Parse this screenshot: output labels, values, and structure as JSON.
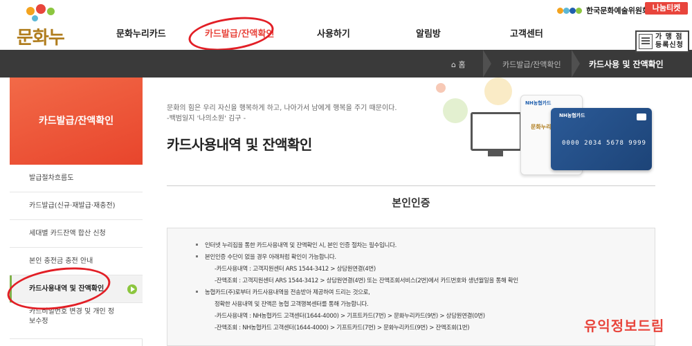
{
  "header": {
    "logo_text": "문화누리",
    "gnb": [
      "문화누리카드",
      "카드발급/잔액확인",
      "사용하기",
      "알림방",
      "고객센터"
    ],
    "org_name": "한국문화예술위원회",
    "nanum_label": "나눔티켓",
    "store_badge": [
      "가 맹 점",
      "등록신청"
    ]
  },
  "breadcrumb": {
    "home": "홈",
    "middle": "카드발급/잔액확인",
    "current": "카드사용 및 잔액확인"
  },
  "sidebar": {
    "title": "카드발급/잔액확인",
    "items": [
      {
        "label": "발급절차흐름도"
      },
      {
        "label": "카드발급(신규·재발급·재충전)"
      },
      {
        "label": "세대별 카드잔액 합산 신청"
      },
      {
        "label": "본인 충전금 충전 안내"
      },
      {
        "label": "카드사용내역 및 잔액확인"
      },
      {
        "label": "카드비밀번호 변경 및 개인 정보수정"
      }
    ]
  },
  "main": {
    "quote_line1": "문화의 힘은 우리 자신을 행복하게 하고, 나아가서 남에게 행복을 주기 때문이다.",
    "quote_line2": "-백범일지 '나의소원' 김구 -",
    "page_title": "카드사용내역 및 잔액확인",
    "section_title": "본인인증",
    "info": {
      "bullet1": "인터넷 누리집을 통한 카드사용내역 및 잔액확인 시, 본인 인증 절차는 필수입니다.",
      "bullet2": "본인인증 수단이 없을 경우 아래처럼 확인이 가능합니다.",
      "sub2_1": "-카드사용내역 : 고객지원센터 ARS 1544-3412 > 상담원연결(4번)",
      "sub2_2": "-잔액조회 : 고객지원센터 ARS 1544-3412 > 상담원연결(4번) 또는 잔액조회서비스(2번)에서 카드번호와 생년월일을 통해 확인",
      "bullet3": "농협카드(주)로부터 카드사용내역을 전송받아 제공하여 드리는 것으로,",
      "sub3_1": "정확한 사용내역 및 잔액은 농협 고객행복센터를 통해 가능합니다.",
      "sub3_2": "-카드사용내역 : NH농협카드 고객센터(1644-4000) > 기프트카드(7번) > 문화누리카드(9번) > 상담원연결(0번)",
      "sub3_3": "-잔액조회 : NH농협카드 고객센터(1644-4000) > 기프트카드(7번) > 문화누리카드(9번) > 잔액조회(1번)"
    }
  },
  "illustration": {
    "card1_brand": "NH농협카드",
    "card1_logo": "문화누리",
    "card2_brand": "NH농협카드",
    "card2_number": "0000 2034 5678 9999"
  },
  "watermark": "유익정보드림",
  "colors": {
    "accent_red": "#e8453c",
    "breadcrumb_bg": "#3a3a3a",
    "sidebar_head": "#ee5a3c",
    "active_green": "#8cc63f",
    "card_blue": "#2b5a97"
  }
}
